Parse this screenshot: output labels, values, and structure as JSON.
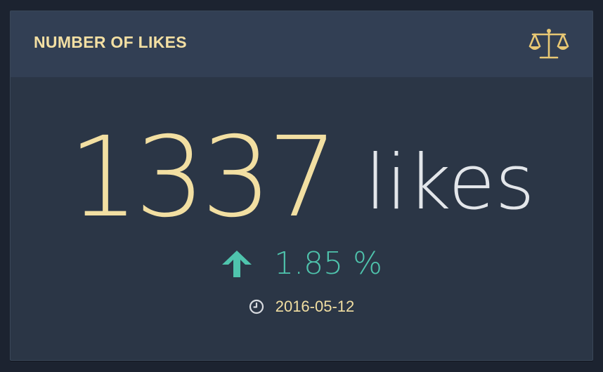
{
  "widget": {
    "title": "NUMBER OF LIKES",
    "icon": "balance-scale-icon",
    "value": "1337",
    "unit": "likes",
    "change": {
      "direction_icon": "arrow-up-icon",
      "value": "1.85 %"
    },
    "date": {
      "icon": "clock-icon",
      "value": "2016-05-12"
    }
  },
  "colors": {
    "page_background": "#1c2330",
    "widget_background": "#2b3646",
    "header_background": "#323f54",
    "accent_gold": "#f2dfa2",
    "accent_teal": "#4fc4ad",
    "unit_text": "#e3e6ea"
  }
}
